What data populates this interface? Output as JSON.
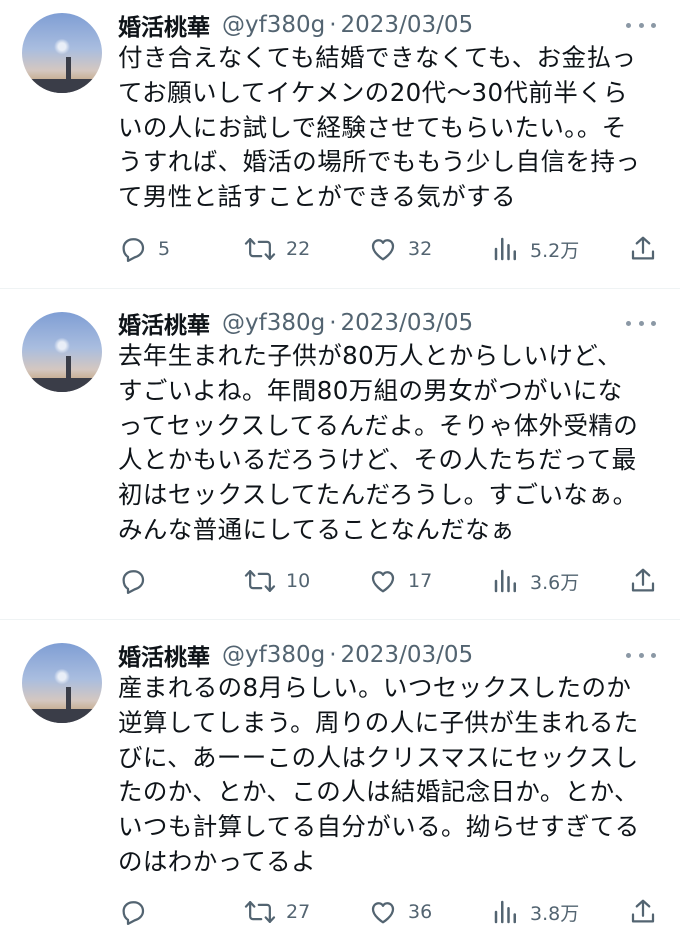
{
  "tweets": [
    {
      "name": "婚活桃華",
      "handle": "@yf380g",
      "separator": "·",
      "date": "2023/03/05",
      "lines": [
        "付き合えなくても結婚できなくても、お金払っ",
        "てお願いしてイケメンの20代〜30代前半くら",
        "いの人にお試しで経験させてもらいたい。。そ",
        "うすれば、婚活の場所でももう少し自信を持っ",
        "て男性と話すことができる気がする"
      ],
      "replies": "5",
      "retweets": "22",
      "likes": "32",
      "views": "5.2万"
    },
    {
      "name": "婚活桃華",
      "handle": "@yf380g",
      "separator": "·",
      "date": "2023/03/05",
      "lines": [
        "去年生まれた子供が80万人とからしいけど、",
        "すごいよね。年間80万組の男女がつがいにな",
        "ってセックスしてるんだよ。そりゃ体外受精の",
        "人とかもいるだろうけど、その人たちだって最",
        "初はセックスしてたんだろうし。すごいなぁ。",
        "みんな普通にしてることなんだなぁ"
      ],
      "replies": "",
      "retweets": "10",
      "likes": "17",
      "views": "3.6万"
    },
    {
      "name": "婚活桃華",
      "handle": "@yf380g",
      "separator": "·",
      "date": "2023/03/05",
      "lines": [
        "産まれるの8月らしい。いつセックスしたのか",
        "逆算してしまう。周りの人に子供が生まれるた",
        "びに、あーーこの人はクリスマスにセックスし",
        "たのか、とか、この人は結婚記念日か。とか、",
        "いつも計算してる自分がいる。拗らせすぎてる",
        "のはわかってるよ"
      ],
      "replies": "",
      "retweets": "27",
      "likes": "36",
      "views": "3.8万"
    }
  ],
  "icons": {
    "reply": "reply-icon",
    "retweet": "retweet-icon",
    "like": "heart-icon",
    "views": "views-icon",
    "share": "share-icon",
    "more": "more-icon"
  }
}
